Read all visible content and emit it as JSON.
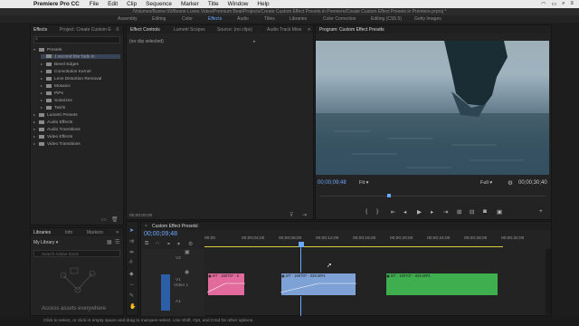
{
  "menubar": {
    "app_name": "Premiere Pro CC",
    "items": [
      "File",
      "Edit",
      "Clip",
      "Sequence",
      "Marker",
      "Title",
      "Window",
      "Help"
    ]
  },
  "titlebar": "/Volumes/Boone 09/Boone Loves Video/Premium Beat/Projects/Create Custom Effect Presets in Premiere/Create Custom Effect Presets in Premiere.prproj *",
  "workspaces": [
    "Assembly",
    "Editing",
    "Color",
    "Effects",
    "Audio",
    "Titles",
    "Libraries",
    "Color Correction",
    "Editing (CS5.5)",
    "Getty Images"
  ],
  "active_workspace": "Effects",
  "effects_panel": {
    "tabs": [
      "Effects",
      "Project: Create Custom E"
    ],
    "search_placeholder": "",
    "tree": [
      {
        "label": "Presets",
        "level": 0,
        "open": true
      },
      {
        "label": "1 second blur fade in",
        "level": 1,
        "selected": true
      },
      {
        "label": "Bevel Edges",
        "level": 1
      },
      {
        "label": "Convolution Kernel",
        "level": 1
      },
      {
        "label": "Lens Distortion Removal",
        "level": 1
      },
      {
        "label": "Mosaics",
        "level": 1
      },
      {
        "label": "PiPs",
        "level": 1
      },
      {
        "label": "Solarizes",
        "level": 1
      },
      {
        "label": "Twirls",
        "level": 1
      },
      {
        "label": "Lumetri Presets",
        "level": 0
      },
      {
        "label": "Audio Effects",
        "level": 0
      },
      {
        "label": "Audio Transitions",
        "level": 0
      },
      {
        "label": "Video Effects",
        "level": 0
      },
      {
        "label": "Video Transitions",
        "level": 0
      }
    ]
  },
  "effect_controls": {
    "tabs": [
      "Effect Controls",
      "Lumetri Scopes",
      "Source: (no clips)",
      "Audio Track Mixe"
    ],
    "empty_text": "(no clip selected)",
    "timecode": "00;00;00;00"
  },
  "program_monitor": {
    "title": "Program: Custom Effect Presets",
    "timecode": "00;00;09;48",
    "fit": "Fit",
    "quality": "Full",
    "duration": "00;00;30;40"
  },
  "libraries": {
    "tabs": [
      "Libraries",
      "Info",
      "Markers"
    ],
    "library_name": "My Library",
    "search_placeholder": "Search Adobe Stock",
    "bottom_text": "Access assets everywhere"
  },
  "timeline": {
    "tab": "Custom Effect Presets",
    "timecode": "00;00;09;48",
    "ruler": [
      "00;00",
      "00;00;04;00",
      "00;00;08;00",
      "00;00;12;00",
      "00;00;16;00",
      "00;00;20;00",
      "00;00;24;00",
      "00;00;28;00",
      "00;00;32;00"
    ],
    "tracks": [
      "V2",
      "V1",
      "A1"
    ],
    "track_names": {
      "V1": "Video 1"
    },
    "clips": [
      {
        "name": "BT - 160707 - 0",
        "color": "#e36a9c"
      },
      {
        "name": "BT - 160707 - 028.MP4",
        "color": "#7fa2d6"
      },
      {
        "name": "BT - 160707 - 029.MP4",
        "color": "#3fae4f"
      }
    ]
  },
  "status": "Click to select, or click in empty space and drag to marquee select. Use Shift, Opt, and Cmd for other options.",
  "colors": {
    "accent": "#6aa8ff",
    "panel": "#232323"
  }
}
